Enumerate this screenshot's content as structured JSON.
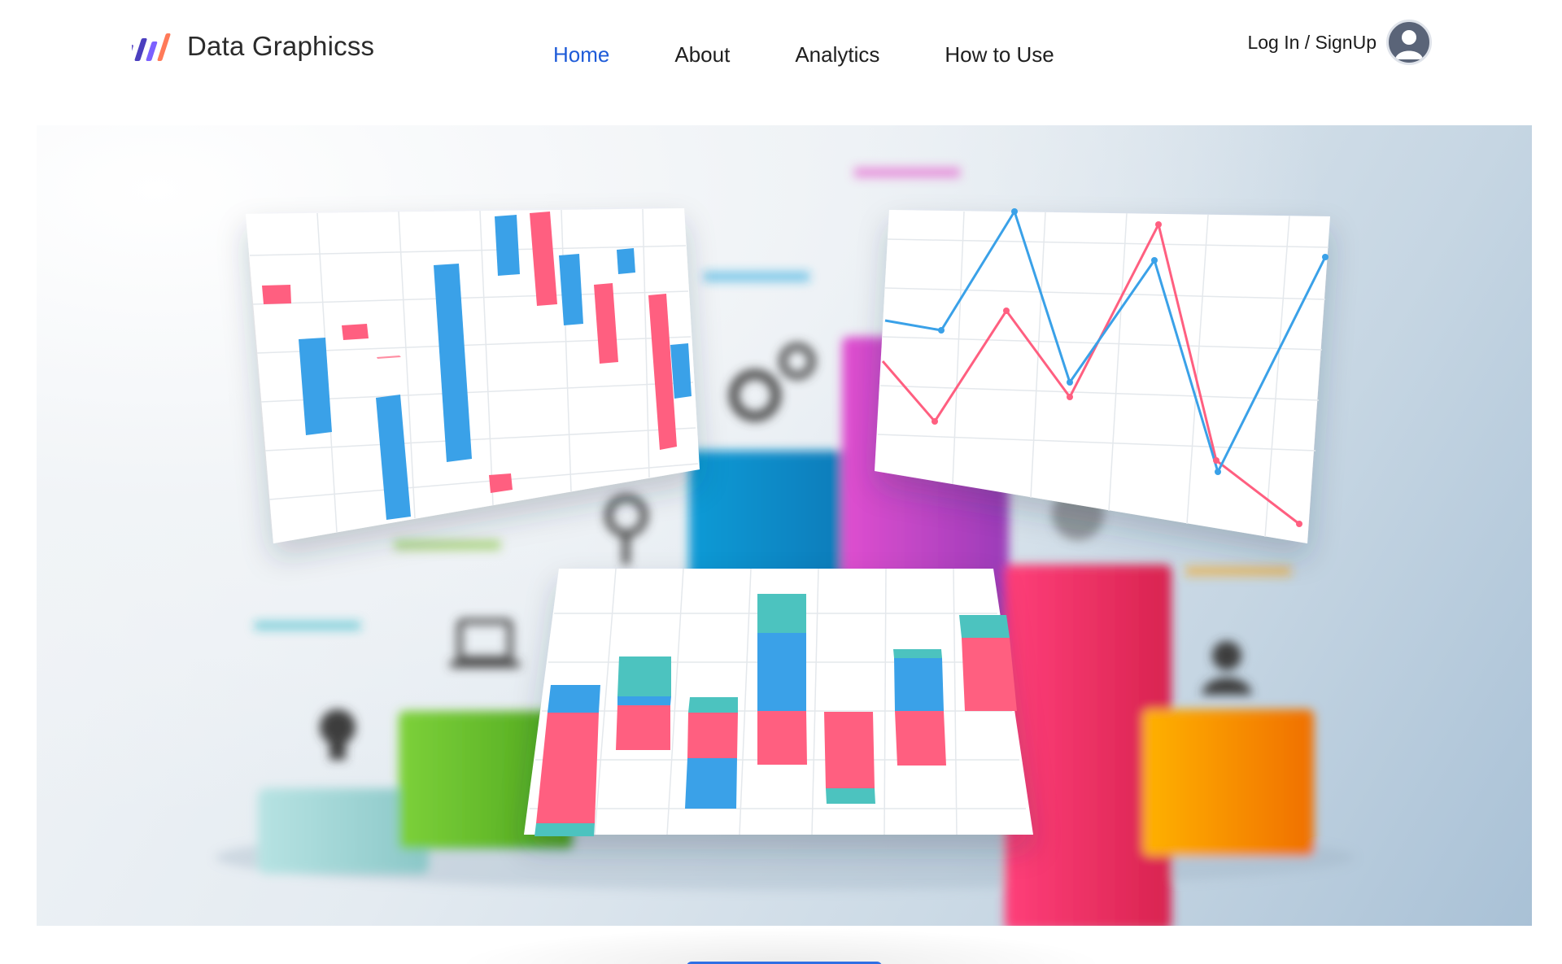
{
  "header": {
    "brand_name": "Data Graphicss",
    "logo_icon": "bar-chart-logo-icon",
    "nav": [
      {
        "label": "Home",
        "active": true
      },
      {
        "label": "About",
        "active": false
      },
      {
        "label": "Analytics",
        "active": false
      },
      {
        "label": "How to Use",
        "active": false
      }
    ],
    "auth_label": "Log In / SignUp",
    "avatar_icon": "user-avatar-icon"
  },
  "colors": {
    "accent": "#1e5bd8",
    "chart_blue": "#3aa1e8",
    "chart_pink": "#ff5f80",
    "chart_teal": "#4cc3bf"
  },
  "hero": {
    "image": "blurred 3D infographic background with three floating chart cards"
  },
  "cta": {
    "label": ""
  }
}
